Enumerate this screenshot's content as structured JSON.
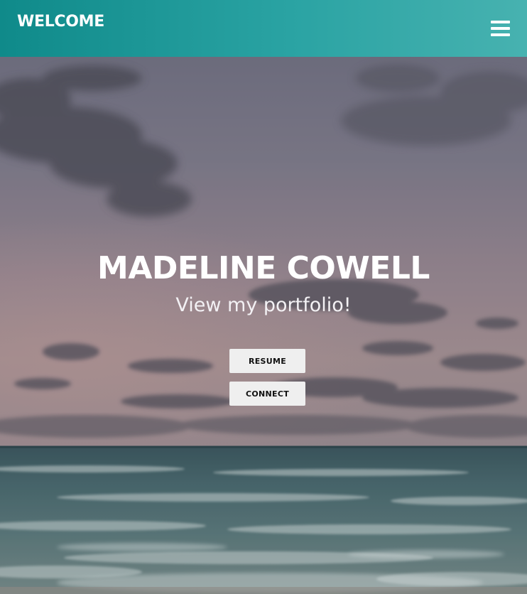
{
  "header": {
    "brand": "WELCOME",
    "menu_icon": "hamburger-menu-icon",
    "gradient_start": "#0f8a8a",
    "gradient_end": "#47b2b0"
  },
  "hero": {
    "name": "MADELINE COWELL",
    "subtitle": "View my portfolio!",
    "buttons": [
      {
        "label": "RESUME"
      },
      {
        "label": "CONNECT"
      }
    ],
    "background": "beach-sunset-photo"
  }
}
